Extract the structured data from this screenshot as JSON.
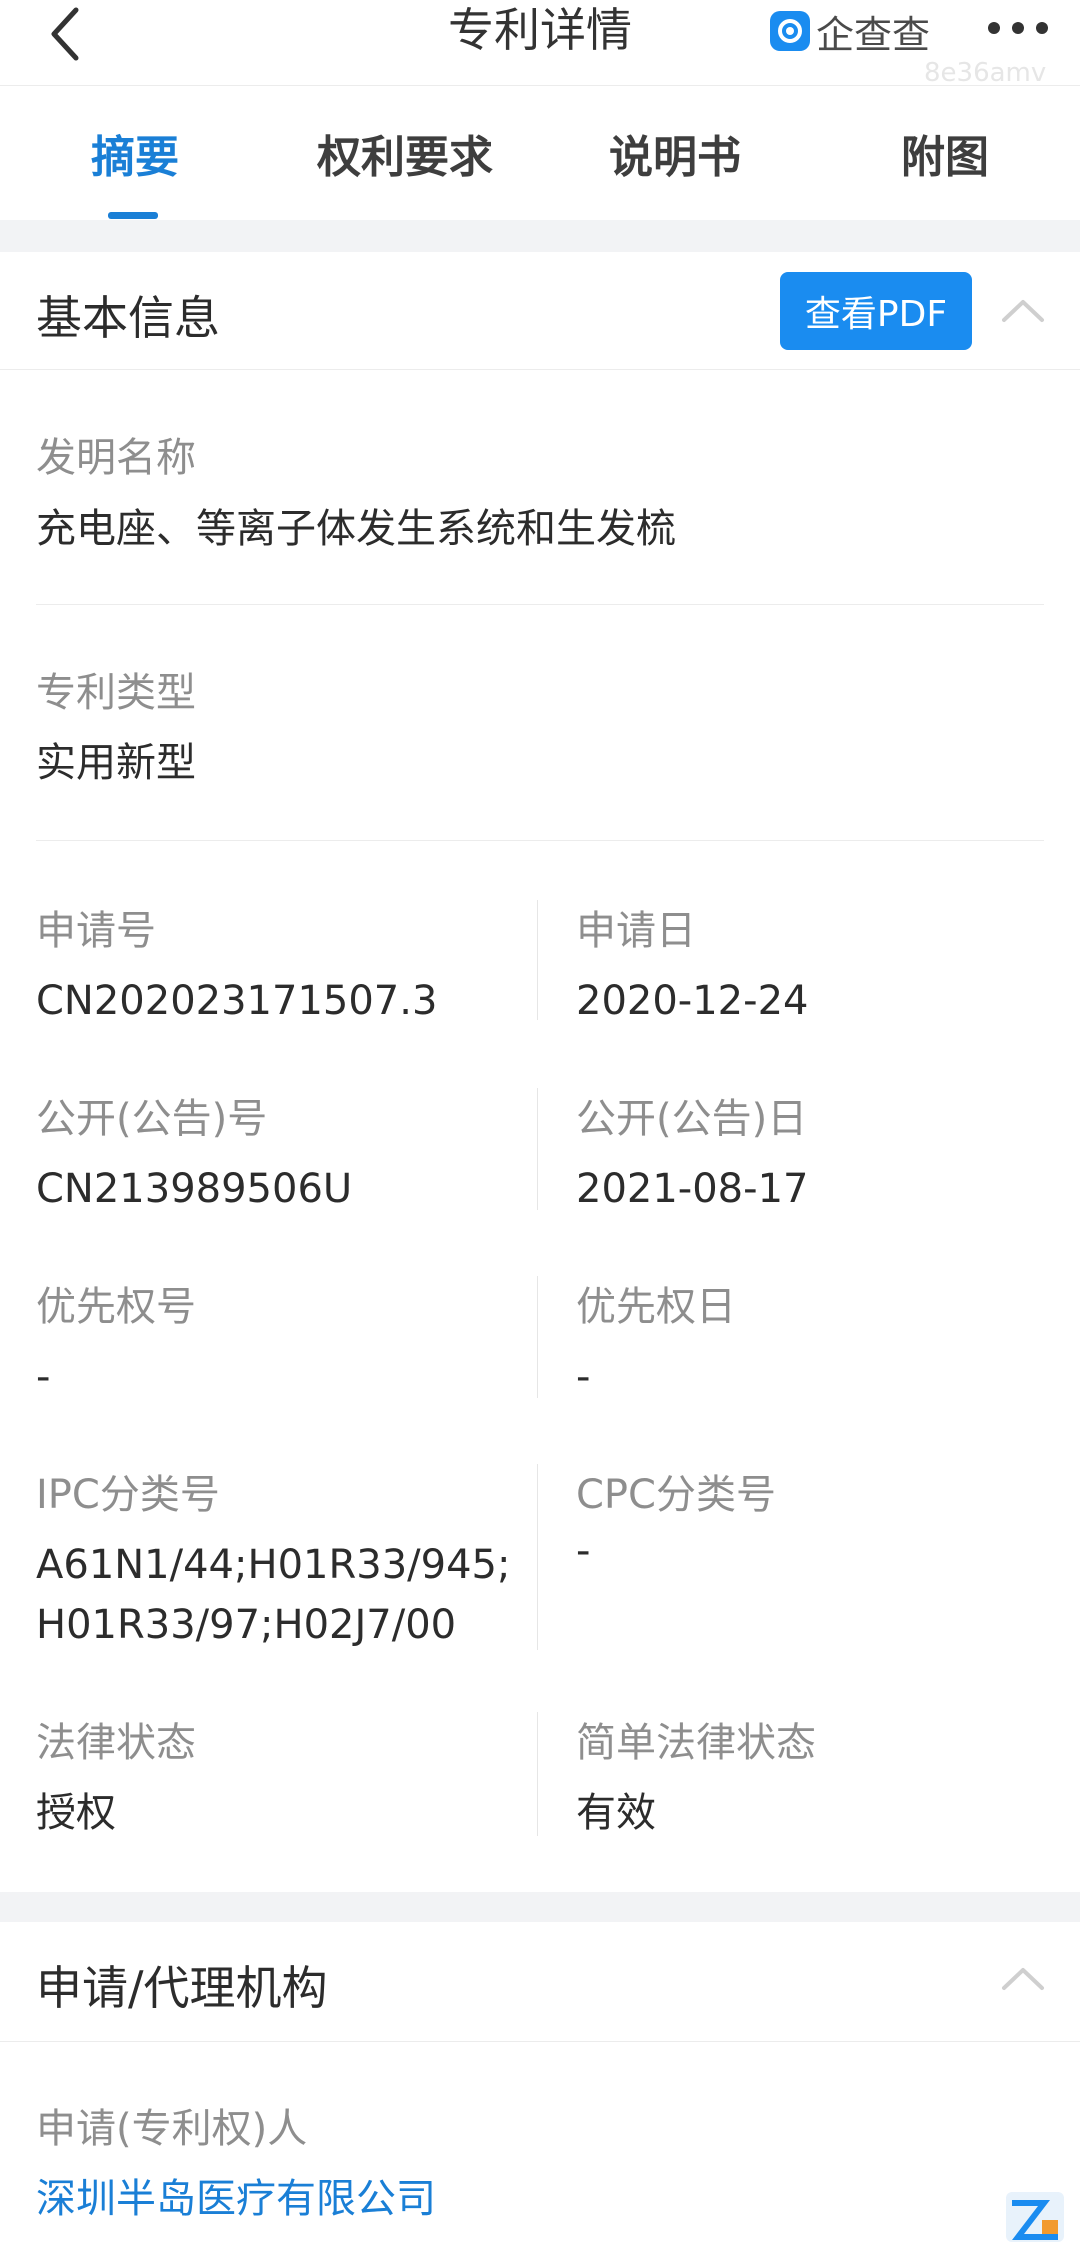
{
  "header": {
    "title": "专利详情",
    "brand_name": "企查查",
    "watermark": "8e36amv"
  },
  "tabs": [
    {
      "label": "摘要",
      "active": true
    },
    {
      "label": "权利要求",
      "active": false
    },
    {
      "label": "说明书",
      "active": false
    },
    {
      "label": "附图",
      "active": false
    }
  ],
  "basic_info": {
    "title": "基本信息",
    "pdf_button": "查看PDF",
    "invention_name": {
      "label": "发明名称",
      "value": "充电座、等离子体发生系统和生发梳"
    },
    "patent_type": {
      "label": "专利类型",
      "value": "实用新型"
    },
    "application_no": {
      "label": "申请号",
      "value": "CN202023171507.3"
    },
    "application_date": {
      "label": "申请日",
      "value": "2020-12-24"
    },
    "publication_no": {
      "label": "公开(公告)号",
      "value": "CN213989506U"
    },
    "publication_date": {
      "label": "公开(公告)日",
      "value": "2021-08-17"
    },
    "priority_no": {
      "label": "优先权号",
      "value": "-"
    },
    "priority_date": {
      "label": "优先权日",
      "value": "-"
    },
    "ipc": {
      "label": "IPC分类号",
      "value_line1": "A61N1/44;H01R33/945;",
      "value_line2": "H01R33/97;H02J7/00"
    },
    "cpc": {
      "label": "CPC分类号",
      "value": "-"
    },
    "legal_status": {
      "label": "法律状态",
      "value": "授权"
    },
    "simple_legal_status": {
      "label": "简单法律状态",
      "value": "有效"
    }
  },
  "agency": {
    "title": "申请/代理机构",
    "applicant": {
      "label": "申请(专利权)人",
      "value": "深圳半岛医疗有限公司"
    }
  },
  "colors": {
    "accent": "#1a7fd6",
    "button": "#1a8cf0",
    "label": "#8e8e8e",
    "divider_band": "#f2f3f5"
  },
  "icons": [
    "back-arrow-icon",
    "brand-logo-icon",
    "more-dots-icon",
    "chevron-up-icon",
    "corner-logo-icon"
  ]
}
